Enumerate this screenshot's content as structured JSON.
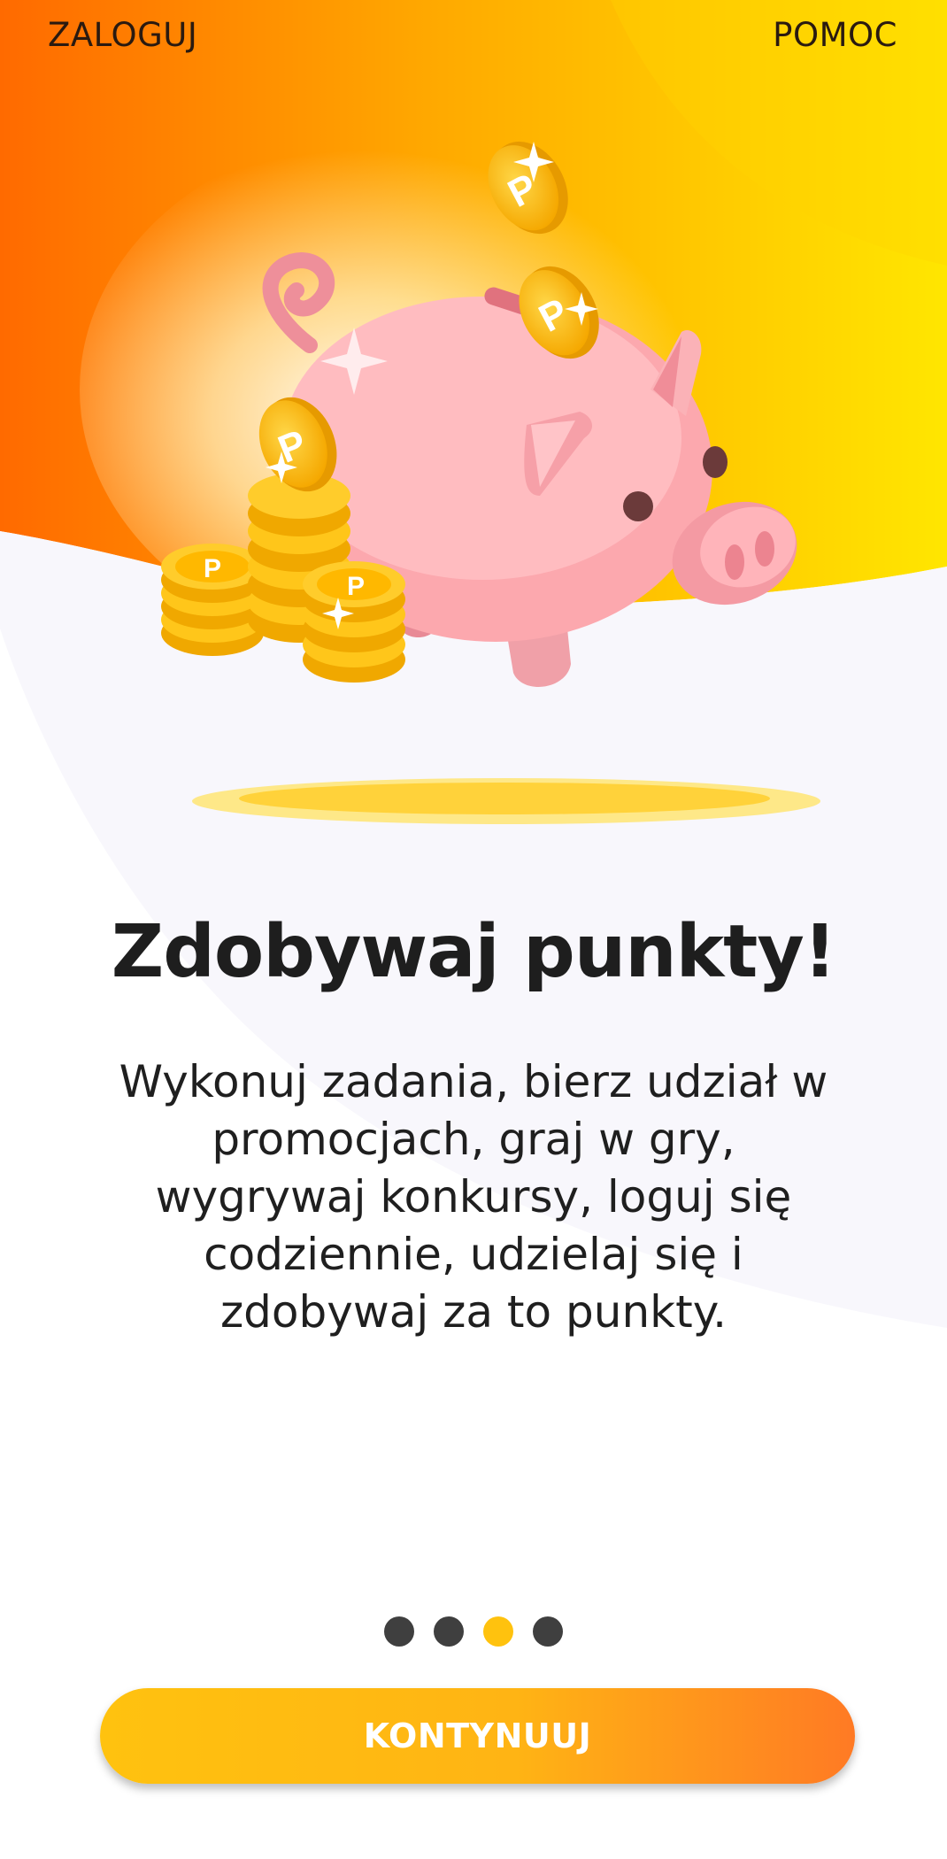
{
  "header": {
    "login_label": "ZALOGUJ",
    "help_label": "POMOC"
  },
  "main": {
    "title": "Zdobywaj punkty!",
    "description": "Wykonuj zadania, bierz udział w promocjach, graj w gry, wygrywaj konkursy, loguj się codziennie, udzielaj się i zdobywaj za to punkty.",
    "coin_symbol": "P"
  },
  "pager": {
    "total": 4,
    "active_index": 2
  },
  "footer": {
    "continue_label": "KONTYNUUJ"
  },
  "colors": {
    "accent_yellow": "#ffc20e",
    "accent_orange": "#ff7a24",
    "dot_inactive": "#3f3f3f"
  }
}
